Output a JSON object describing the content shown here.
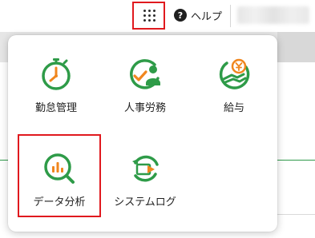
{
  "header": {
    "apps_button_icon": "grid-dots-icon",
    "help_icon_glyph": "?",
    "help_label": "ヘルプ",
    "user_name": ""
  },
  "launcher": {
    "apps": [
      {
        "label": "勤怠管理",
        "icon": "stopwatch-icon"
      },
      {
        "label": "人事労務",
        "icon": "person-check-icon"
      },
      {
        "label": "給与",
        "icon": "yen-hand-icon"
      },
      {
        "label": "データ分析",
        "icon": "magnifier-chart-icon",
        "selected": true
      },
      {
        "label": "システムログ",
        "icon": "log-refresh-icon"
      }
    ]
  },
  "colors": {
    "green": "#2e9b48",
    "orange": "#f0861e",
    "highlight_red": "#e0191e"
  }
}
